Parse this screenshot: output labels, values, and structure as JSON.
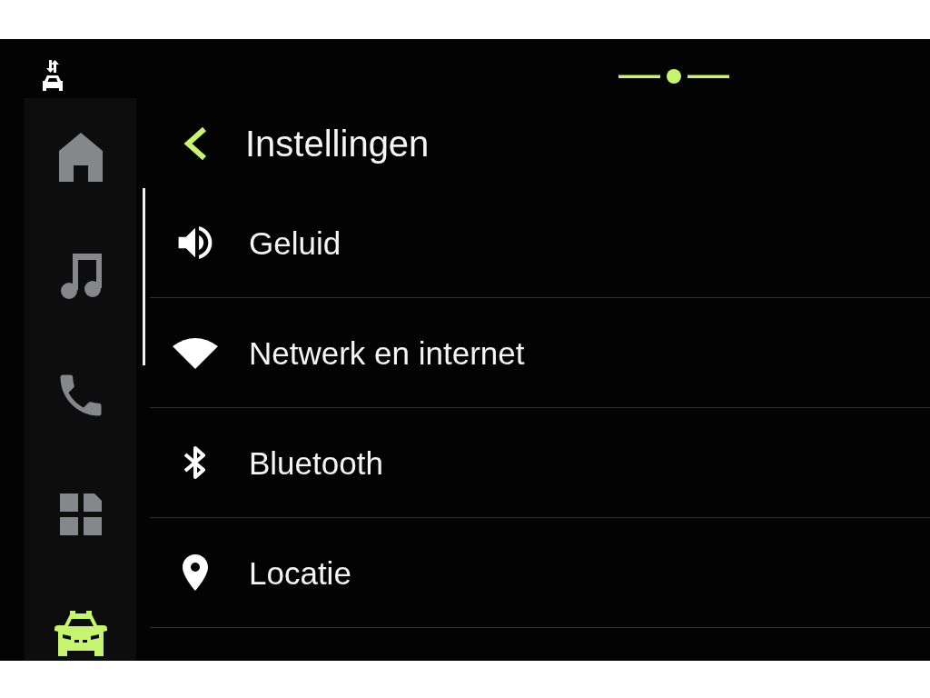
{
  "sidebar": {
    "items": [
      {
        "kind": "home",
        "selected": false
      },
      {
        "kind": "music",
        "selected": false
      },
      {
        "kind": "phone",
        "selected": false
      },
      {
        "kind": "apps",
        "selected": false
      },
      {
        "kind": "car",
        "selected": true
      }
    ]
  },
  "header": {
    "title": "Instellingen"
  },
  "settings_list": {
    "items": [
      {
        "kind": "sound",
        "label": "Geluid"
      },
      {
        "kind": "network",
        "label": "Netwerk en internet"
      },
      {
        "kind": "bluetooth",
        "label": "Bluetooth"
      },
      {
        "kind": "location",
        "label": "Locatie"
      }
    ]
  }
}
